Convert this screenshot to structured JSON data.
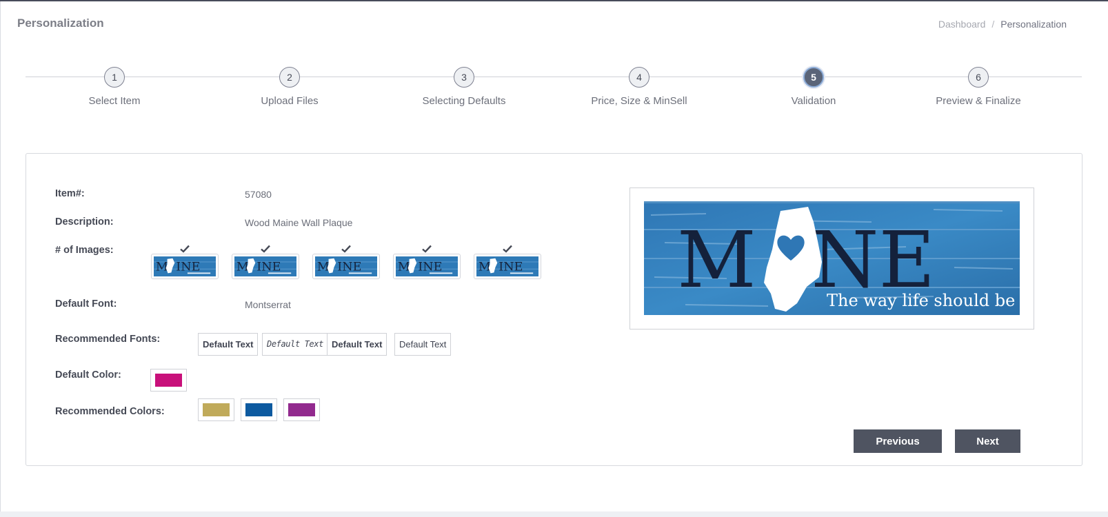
{
  "header": {
    "page_title": "Personalization",
    "breadcrumb": [
      {
        "label": "Dashboard"
      },
      {
        "label": "Personalization"
      }
    ]
  },
  "stepper": {
    "steps": [
      {
        "number": "1",
        "label": "Select Item",
        "state": "default"
      },
      {
        "number": "2",
        "label": "Upload Files",
        "state": "default"
      },
      {
        "number": "3",
        "label": "Selecting Defaults",
        "state": "default"
      },
      {
        "number": "4",
        "label": "Price, Size & MinSell",
        "state": "default"
      },
      {
        "number": "5",
        "label": "Validation",
        "state": "active"
      },
      {
        "number": "6",
        "label": "Preview & Finalize",
        "state": "default"
      }
    ]
  },
  "details": {
    "item_label": "Item#:",
    "item_value": "57080",
    "description_label": "Description:",
    "description_value": "Wood Maine Wall Plaque",
    "images_label": "# of Images:",
    "images": [
      {
        "checked": true,
        "icon": "check-icon"
      },
      {
        "checked": true,
        "icon": "check-icon"
      },
      {
        "checked": true,
        "icon": "check-icon"
      },
      {
        "checked": true,
        "icon": "check-icon"
      },
      {
        "checked": true,
        "icon": "check-icon"
      }
    ],
    "default_font_label": "Default Font:",
    "default_font_value": "Montserrat",
    "recommended_fonts_label": "Recommended Fonts:",
    "recommended_fonts": [
      "Default Text",
      "Default Text",
      "Default Text",
      "Default Text"
    ],
    "default_color_label": "Default Color:",
    "default_color": "#c8107a",
    "recommended_colors_label": "Recommended Colors:",
    "recommended_colors": [
      "#c0aa5a",
      "#0d5aa0",
      "#922a8e"
    ]
  },
  "preview": {
    "main_text": "M INE",
    "tagline": "The way life should be"
  },
  "actions": {
    "previous_label": "Previous",
    "next_label": "Next"
  },
  "colors": {
    "accent_button": "#4f5461",
    "active_step": "#5a6478",
    "plaque_blue": "#2e7ab7"
  }
}
